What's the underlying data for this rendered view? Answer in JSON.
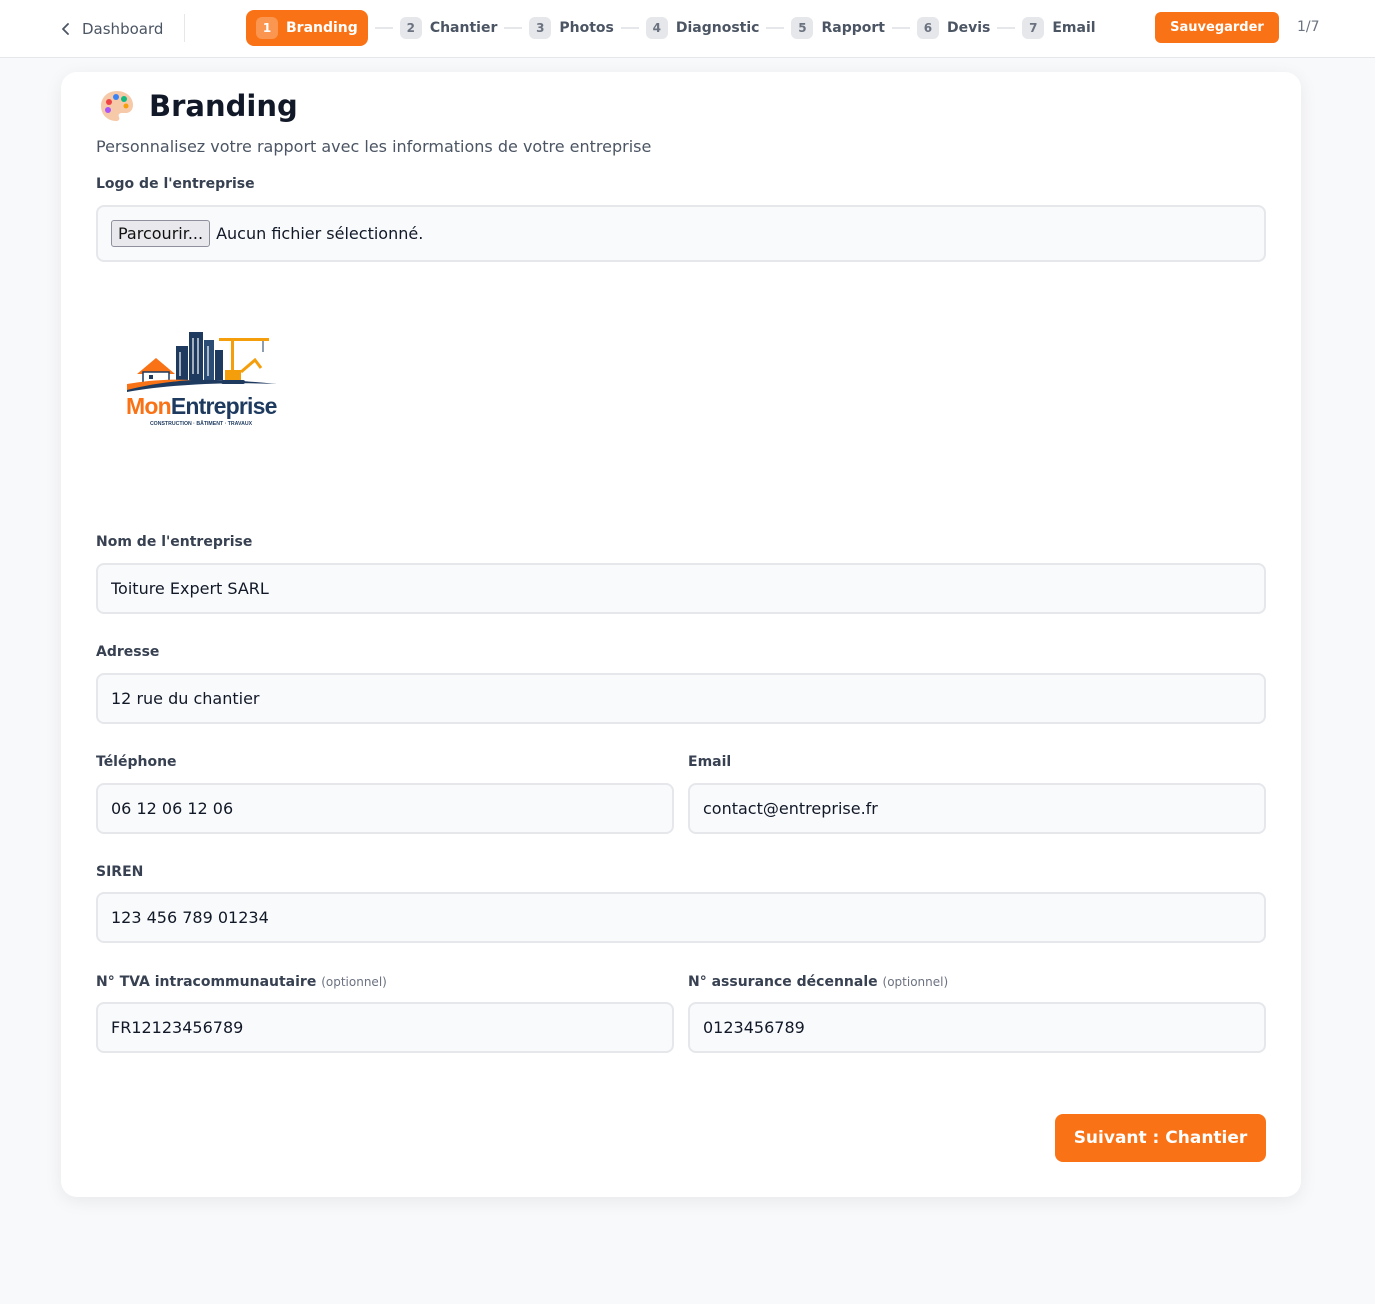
{
  "header": {
    "back_label": "Dashboard",
    "save_label": "Sauvegarder",
    "page_counter": "1/7",
    "steps": [
      {
        "num": "1",
        "label": "Branding"
      },
      {
        "num": "2",
        "label": "Chantier"
      },
      {
        "num": "3",
        "label": "Photos"
      },
      {
        "num": "4",
        "label": "Diagnostic"
      },
      {
        "num": "5",
        "label": "Rapport"
      },
      {
        "num": "6",
        "label": "Devis"
      },
      {
        "num": "7",
        "label": "Email"
      }
    ]
  },
  "page": {
    "title": "Branding",
    "subtitle": "Personnalisez votre rapport avec les informations de votre entreprise"
  },
  "logo": {
    "label": "Logo de l'entreprise",
    "browse_label": "Parcourir...",
    "no_file_text": "Aucun fichier sélectionné.",
    "preview_name": "MonEntreprise",
    "preview_name_part1": "Mon",
    "preview_name_part2": "Entreprise",
    "preview_tagline": "CONSTRUCTION · BÂTIMENT · TRAVAUX"
  },
  "form": {
    "company_name": {
      "label": "Nom de l'entreprise",
      "value": "Toiture Expert SARL"
    },
    "address": {
      "label": "Adresse",
      "value": "12 rue du chantier"
    },
    "phone": {
      "label": "Téléphone",
      "value": "06 12 06 12 06"
    },
    "email": {
      "label": "Email",
      "value": "contact@entreprise.fr"
    },
    "siren": {
      "label": "SIREN",
      "value": "123 456 789 01234"
    },
    "tva": {
      "label": "N° TVA intracommunautaire",
      "optional": "(optionnel)",
      "value": "FR12123456789"
    },
    "insurance": {
      "label": "N° assurance décennale",
      "optional": "(optionnel)",
      "value": "0123456789"
    }
  },
  "footer": {
    "next_label": "Suivant : Chantier"
  },
  "colors": {
    "accent": "#f97316",
    "logo_navy": "#1e3a5f",
    "logo_orange": "#f97316"
  }
}
